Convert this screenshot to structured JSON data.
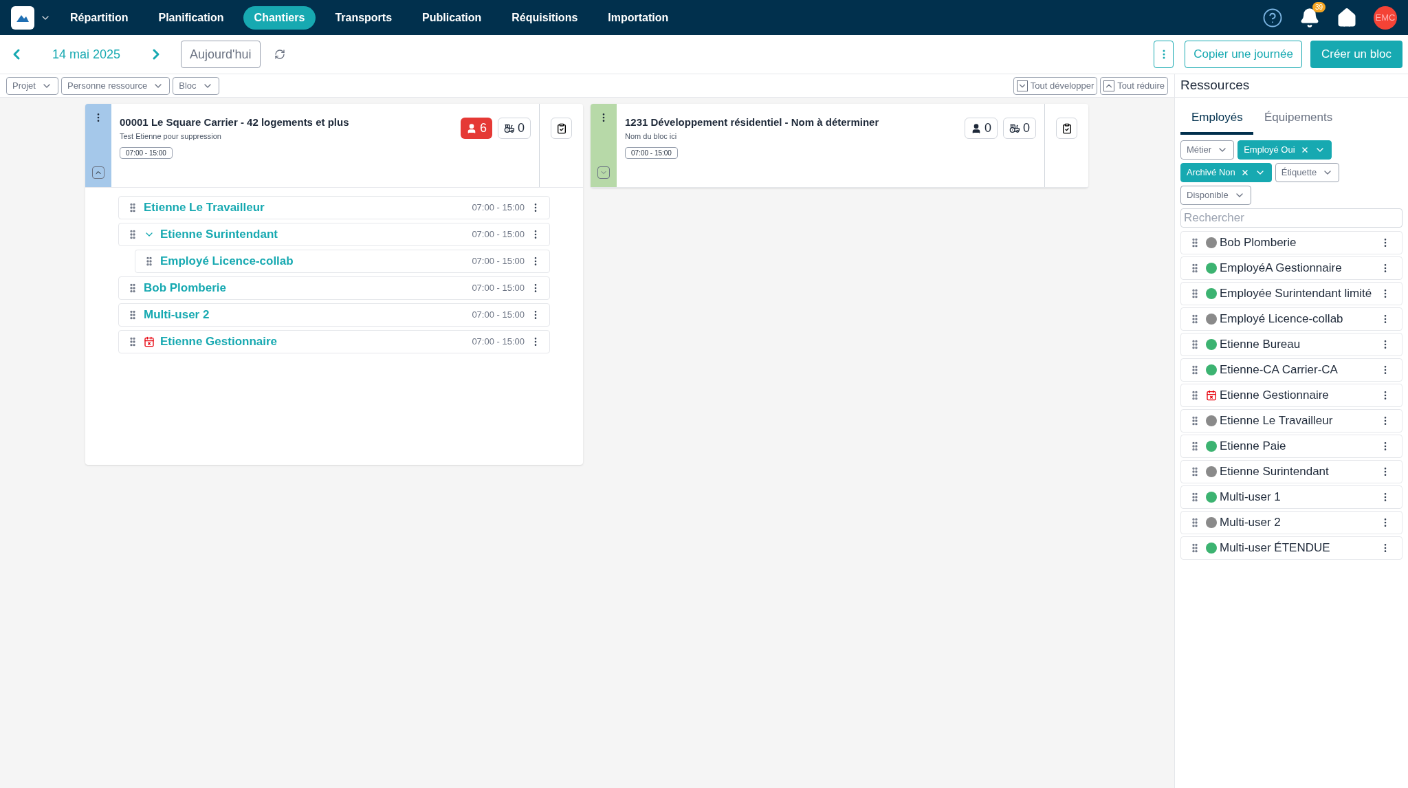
{
  "nav": {
    "items": [
      {
        "label": "Répartition",
        "selected": false
      },
      {
        "label": "Planification",
        "selected": false
      },
      {
        "label": "Chantiers",
        "selected": true
      },
      {
        "label": "Transports",
        "selected": false
      },
      {
        "label": "Publication",
        "selected": false
      },
      {
        "label": "Réquisitions",
        "selected": false
      },
      {
        "label": "Importation",
        "selected": false
      }
    ],
    "notification_count": "39",
    "avatar": "EMC"
  },
  "toolbar": {
    "date": "14 mai 2025",
    "today": "Aujourd'hui",
    "copy": "Copier une journée",
    "create": "Créer un bloc"
  },
  "filters": [
    "Projet",
    "Personne ressource",
    "Bloc"
  ],
  "expand_all": "Tout développer",
  "collapse_all": "Tout réduire",
  "blocks": [
    {
      "title": "00001 Le Square Carrier - 42 logements et plus",
      "subtitle": "Test Etienne pour suppression",
      "hours": "07:00 - 15:00",
      "color": "#a5c8ea",
      "expanded": true,
      "people": "6",
      "people_alert": true,
      "equipment": "0",
      "employees": [
        {
          "name": "Etienne Le Travailleur",
          "hours": "07:00 - 15:00",
          "absent": false
        },
        {
          "name": "Etienne Surintendant",
          "hours": "07:00 - 15:00",
          "absent": false,
          "expanded": true,
          "children": [
            {
              "name": "Employé Licence-collab",
              "hours": "07:00 - 15:00",
              "absent": false
            }
          ]
        },
        {
          "name": "Bob Plomberie",
          "hours": "07:00 - 15:00",
          "absent": false
        },
        {
          "name": "Multi-user 2",
          "hours": "07:00 - 15:00",
          "absent": false
        },
        {
          "name": "Etienne Gestionnaire",
          "hours": "07:00 - 15:00",
          "absent": true
        }
      ]
    },
    {
      "title": "1231 Développement résidentiel - Nom à déterminer",
      "subtitle": "Nom du bloc ici",
      "hours": "07:00 - 15:00",
      "color": "#b7d9a8",
      "expanded": false,
      "people": "0",
      "people_alert": false,
      "equipment": "0"
    }
  ],
  "resources": {
    "title": "Ressources",
    "tabs": [
      {
        "label": "Employés",
        "selected": true
      },
      {
        "label": "Équipements",
        "selected": false
      }
    ],
    "filters": [
      {
        "label": "Métier",
        "active": false
      },
      {
        "label": "Employé Oui",
        "active": true
      },
      {
        "label": "Archivé Non",
        "active": true
      },
      {
        "label": "Étiquette",
        "active": false
      },
      {
        "label": "Disponible",
        "active": false
      }
    ],
    "search": {
      "placeholder": "Rechercher"
    },
    "items": [
      {
        "name": "Bob Plomberie",
        "kind": "dot",
        "color": "#8a8a8a"
      },
      {
        "name": "EmployéA Gestionnaire",
        "kind": "dot",
        "color": "#3cb371"
      },
      {
        "name": "Employée Surintendant limité",
        "kind": "dot",
        "color": "#3cb371"
      },
      {
        "name": "Employé Licence-collab",
        "kind": "dot",
        "color": "#8a8a8a"
      },
      {
        "name": "Etienne Bureau",
        "kind": "dot",
        "color": "#3cb371"
      },
      {
        "name": "Etienne-CA Carrier-CA",
        "kind": "dot",
        "color": "#3cb371"
      },
      {
        "name": "Etienne Gestionnaire",
        "kind": "absent"
      },
      {
        "name": "Etienne Le Travailleur",
        "kind": "dot",
        "color": "#8a8a8a"
      },
      {
        "name": "Etienne Paie",
        "kind": "dot",
        "color": "#3cb371"
      },
      {
        "name": "Etienne Surintendant",
        "kind": "dot",
        "color": "#8a8a8a"
      },
      {
        "name": "Multi-user 1",
        "kind": "dot",
        "color": "#3cb371"
      },
      {
        "name": "Multi-user 2",
        "kind": "dot",
        "color": "#8a8a8a"
      },
      {
        "name": "Multi-user ÉTENDUE",
        "kind": "dot",
        "color": "#3cb371"
      }
    ]
  }
}
